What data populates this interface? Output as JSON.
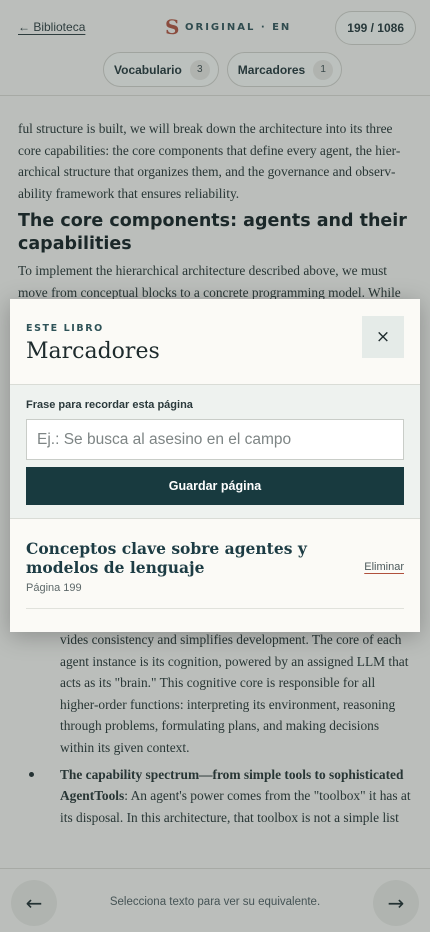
{
  "header": {
    "back_label": "← Biblioteca",
    "brand_logo_letter": "S",
    "brand_text": "ORIGINAL · EN",
    "page_counter": "199 / 1086",
    "chips": [
      {
        "label": "Vocabulario",
        "count": "3"
      },
      {
        "label": "Marcadores",
        "count": "1"
      }
    ]
  },
  "content": {
    "paragraph_1": "ful structure is built, we will break down the architecture into its three core capabilities: the core components that define every agent, the hier-archical structure that organizes them, and the governance and observ-ability framework that ensures reliability.",
    "heading": "The core components: agents and their capabilities",
    "paragraph_2": "To implement the hierarchical architecture described above, we must move from conceptual blocks to a concrete programming model. While",
    "lower_paragraph": "vides consistency and simplifies development. The core of each agent instance is its cognition, powered by an assigned LLM that acts as its \"brain.\" This cognitive core is responsible for all higher-order functions: interpreting its environment, reasoning through problems, formulating plans, and making decisions within its given context.",
    "bullet_bold": "The capability spectrum—from simple tools to sophisticated AgentTools",
    "bullet_text": ": An agent's power comes from the \"toolbox\" it has at its disposal. In this architecture, that toolbox is not a simple list"
  },
  "footer": {
    "prev_icon": "←",
    "next_icon": "→",
    "hint": "Selecciona texto para ver su equivalente."
  },
  "modal": {
    "kicker": "ESTE LIBRO",
    "title": "Marcadores",
    "close_icon": "×",
    "form_label": "Frase para recordar esta página",
    "input_value": "",
    "input_placeholder": "Ej.: Se busca al asesino en el campo",
    "save_label": "Guardar página",
    "bookmarks": [
      {
        "title": "Conceptos clave sobre agentes y modelos de lenguaje",
        "page": "Página 199",
        "delete_label": "Eliminar"
      }
    ]
  },
  "colors": {
    "accent_dark": "#183a3f",
    "brand_red": "#b0503c",
    "background": "#f5f3ee"
  }
}
